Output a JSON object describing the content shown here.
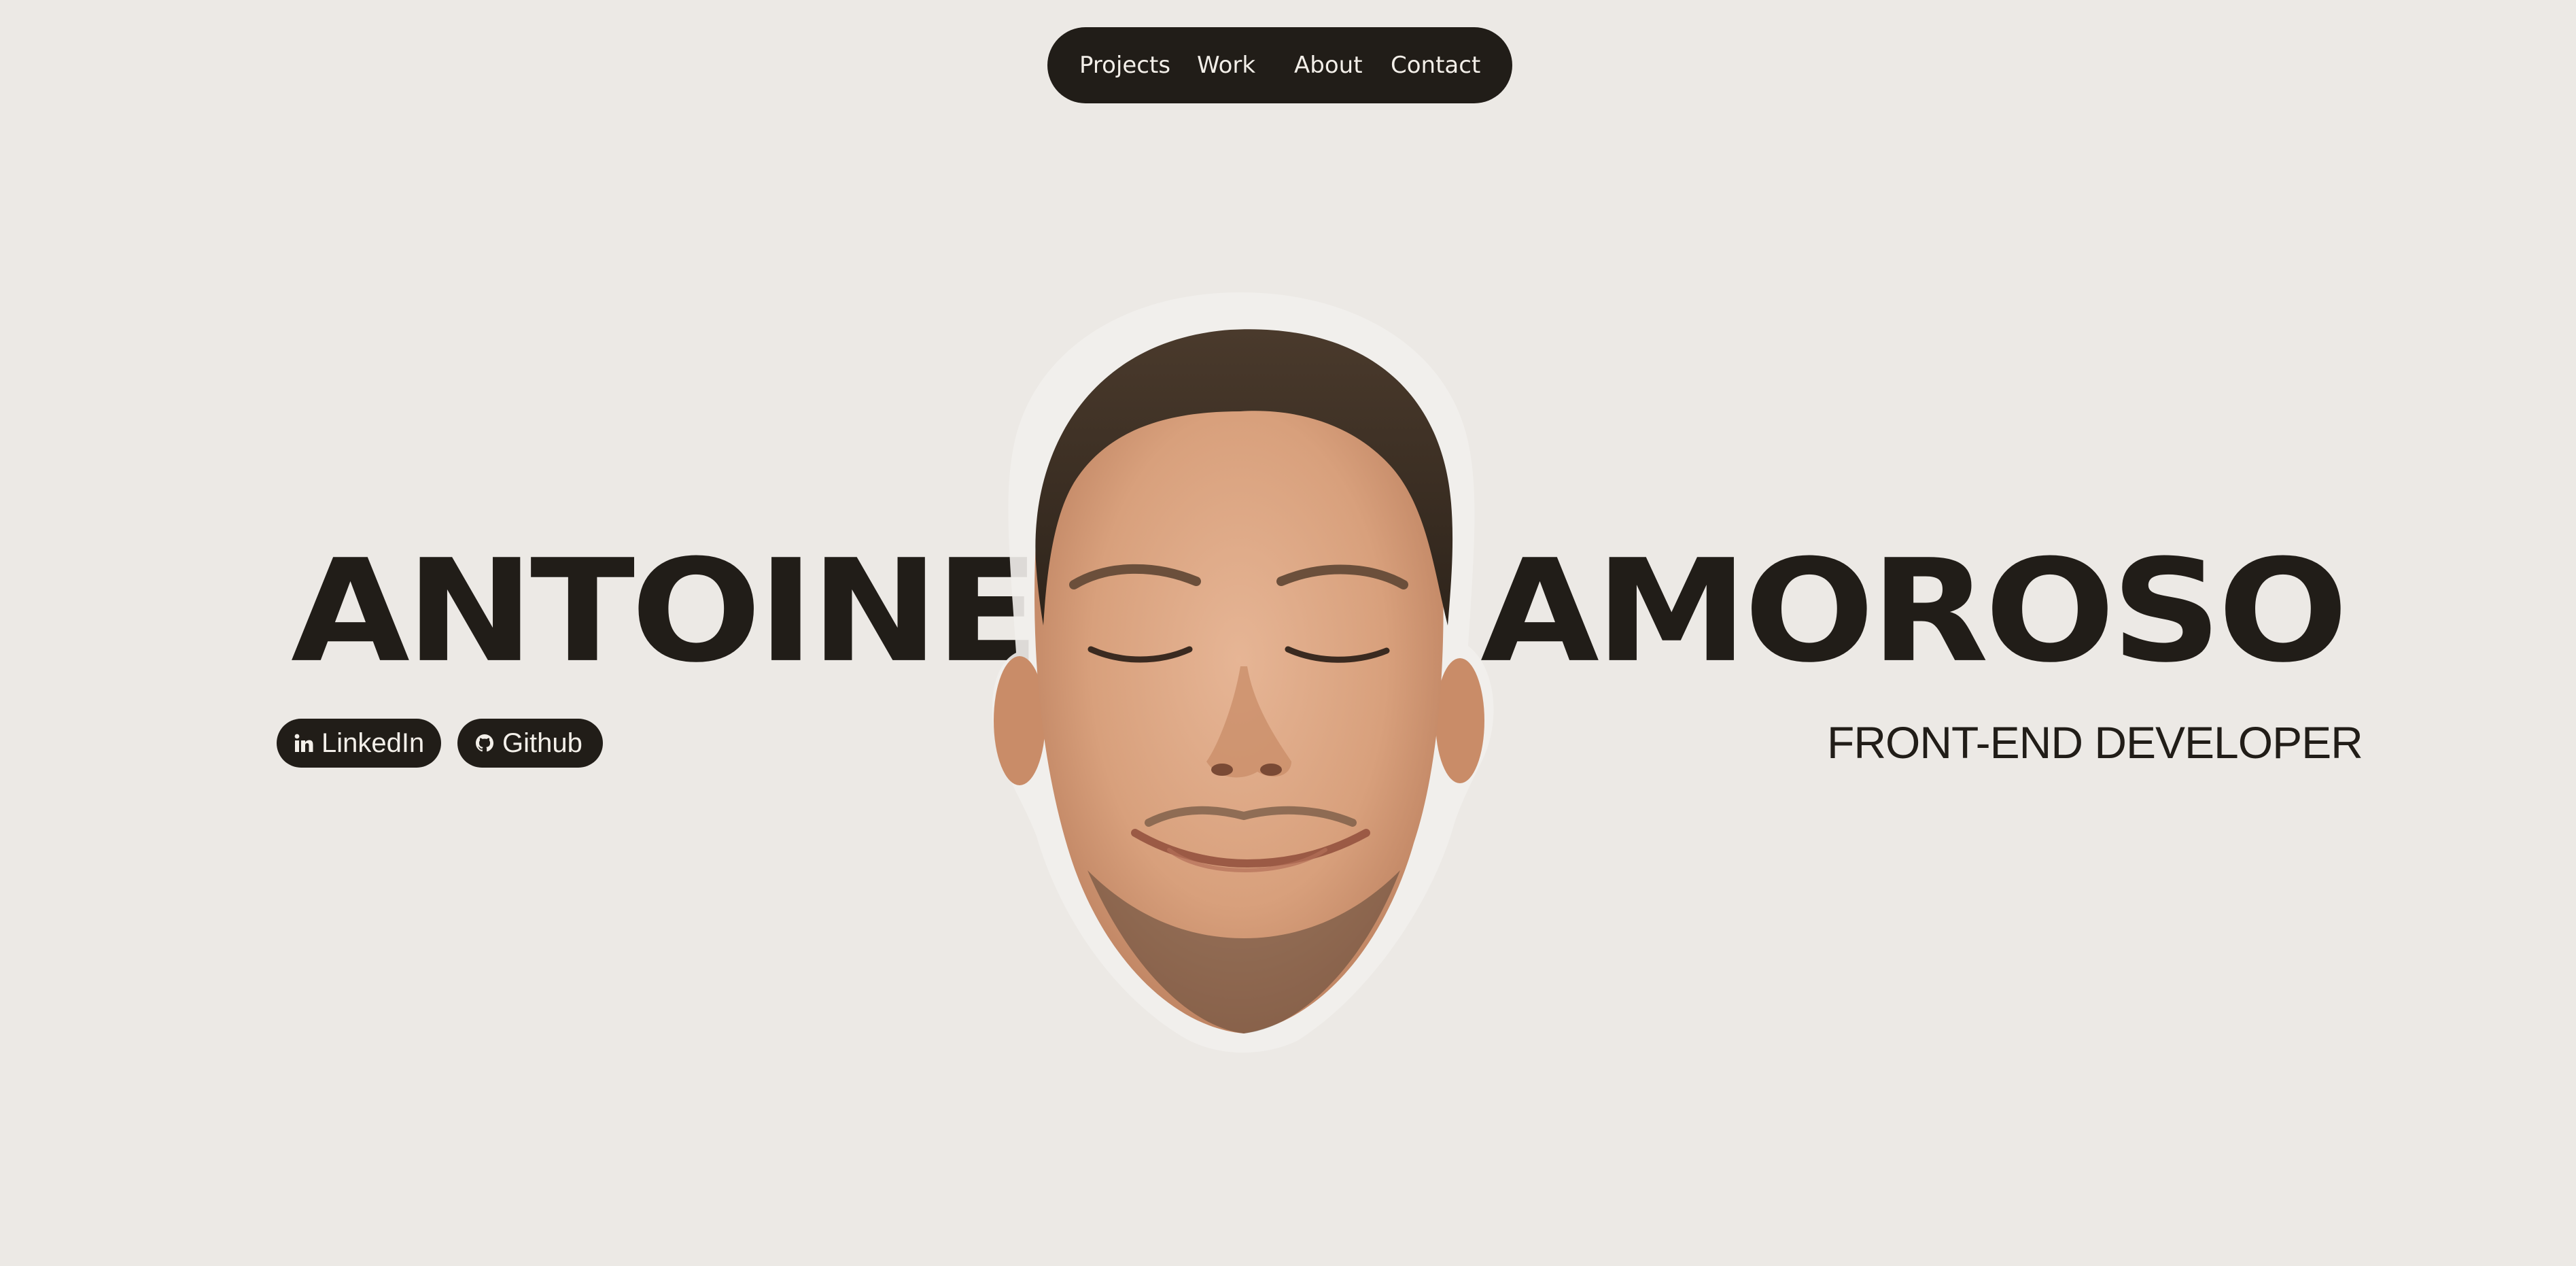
{
  "nav": {
    "items": [
      {
        "label": "Projects"
      },
      {
        "label": "Work"
      },
      {
        "label": "About"
      },
      {
        "label": "Contact"
      }
    ]
  },
  "hero": {
    "first_name": "ANTOINE",
    "last_name": "AMOROSO",
    "role": "FRONT-END DEVELOPER"
  },
  "social": {
    "linkedin": {
      "label": "LinkedIn",
      "icon": "linkedin-icon"
    },
    "github": {
      "label": "Github",
      "icon": "github-icon"
    }
  },
  "colors": {
    "background": "#ece9e5",
    "ink": "#211d18",
    "light_text": "#f3efe9"
  }
}
